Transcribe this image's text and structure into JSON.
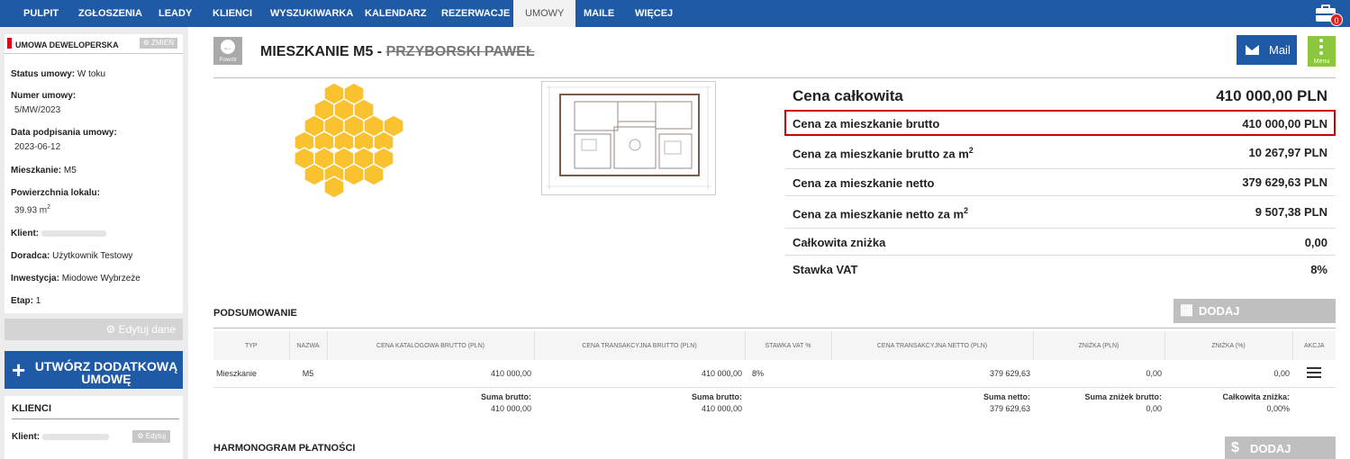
{
  "nav": {
    "items": [
      "PULPIT",
      "ZGŁOSZENIA",
      "LEADY",
      "KLIENCI",
      "WYSZUKIWARKA",
      "KALENDARZ",
      "REZERWACJE",
      "UMOWY",
      "MAILE",
      "WIĘCEJ"
    ],
    "active": "UMOWY",
    "cart_badge": "0"
  },
  "sidebar": {
    "contract_title": "UMOWA DEWELOPERSKA",
    "change_label": "ZMIEŃ",
    "status_label": "Status umowy:",
    "status_value": "W toku",
    "number_label": "Numer umowy:",
    "number_value": "5/MW/2023",
    "signed_label": "Data podpisania umowy:",
    "signed_value": "2023-06-12",
    "apartment_label": "Mieszkanie:",
    "apartment_value": "M5",
    "area_label": "Powierzchnia lokalu:",
    "area_value": "39.93 m",
    "area_sup": "2",
    "client_label": "Klient:",
    "advisor_label": "Doradca:",
    "advisor_value": "Użytkownik Testowy",
    "investment_label": "Inwestycja:",
    "investment_value": "Miodowe Wybrzeże",
    "stage_label": "Etap:",
    "stage_value": "1",
    "edit_data_label": "Edytuj dane",
    "create_button": "UTWÓRZ DODATKOWĄ UMOWĘ",
    "clients_title": "KLIENCI",
    "clients_client_label": "Klient:",
    "clients_edit_label": "Edytuj"
  },
  "header": {
    "back_label": "Powrót",
    "title": "MIESZKANIE M5 - ",
    "title_strike": "PRZYBORSKI PAWEŁ",
    "mail_label": "Mail",
    "menu_label": "Menu"
  },
  "prices": {
    "total_label": "Cena całkowita",
    "total_value": "410 000,00 PLN",
    "rows": [
      {
        "label": "Cena za mieszkanie brutto",
        "value": "410 000,00 PLN"
      },
      {
        "label": "Cena za mieszkanie brutto za m",
        "value": "10 267,97 PLN"
      },
      {
        "label": "Cena za mieszkanie netto",
        "value": "379 629,63 PLN"
      },
      {
        "label": "Cena za mieszkanie netto za m",
        "value": "9 507,38 PLN"
      },
      {
        "label": "Całkowita zniżka",
        "value": "0,00"
      },
      {
        "label": "Stawka VAT",
        "value": "8%"
      }
    ],
    "sup": "2"
  },
  "summary": {
    "title": "PODSUMOWANIE",
    "add_button": "DODAJ PRZYLEGŁOŚĆ",
    "columns": [
      "TYP",
      "NAZWA",
      "CENA KATALOGOWA BRUTTO (PLN)",
      "CENA TRANSAKCYJNA BRUTTO (PLN)",
      "STAWKA VAT %",
      "CENA TRANSAKCYJNA NETTO (PLN)",
      "ZNIŻKA (PLN)",
      "ZNIŻKA (%)",
      "AKCJA"
    ],
    "row": {
      "typ": "Mieszkanie",
      "nazwa": "M5",
      "katalogowa": "410 000,00",
      "transakcyjna": "410 000,00",
      "vat": "8%",
      "netto": "379 629,63",
      "znizka_pln": "0,00",
      "znizka_pct": "0,00"
    },
    "totals": {
      "brutto_cat_label": "Suma brutto:",
      "brutto_cat_value": "410 000,00",
      "brutto_tr_label": "Suma brutto:",
      "brutto_tr_value": "410 000,00",
      "netto_label": "Suma netto:",
      "netto_value": "379 629,63",
      "discount_label": "Suma zniżek brutto:",
      "discount_value": "0,00",
      "total_discount_label": "Całkowita zniżka:",
      "total_discount_value": "0,00%"
    }
  },
  "schedule": {
    "title": "HARMONOGRAM PŁATNOŚCI",
    "add_button": "DODAJ TRANSZĘ"
  }
}
